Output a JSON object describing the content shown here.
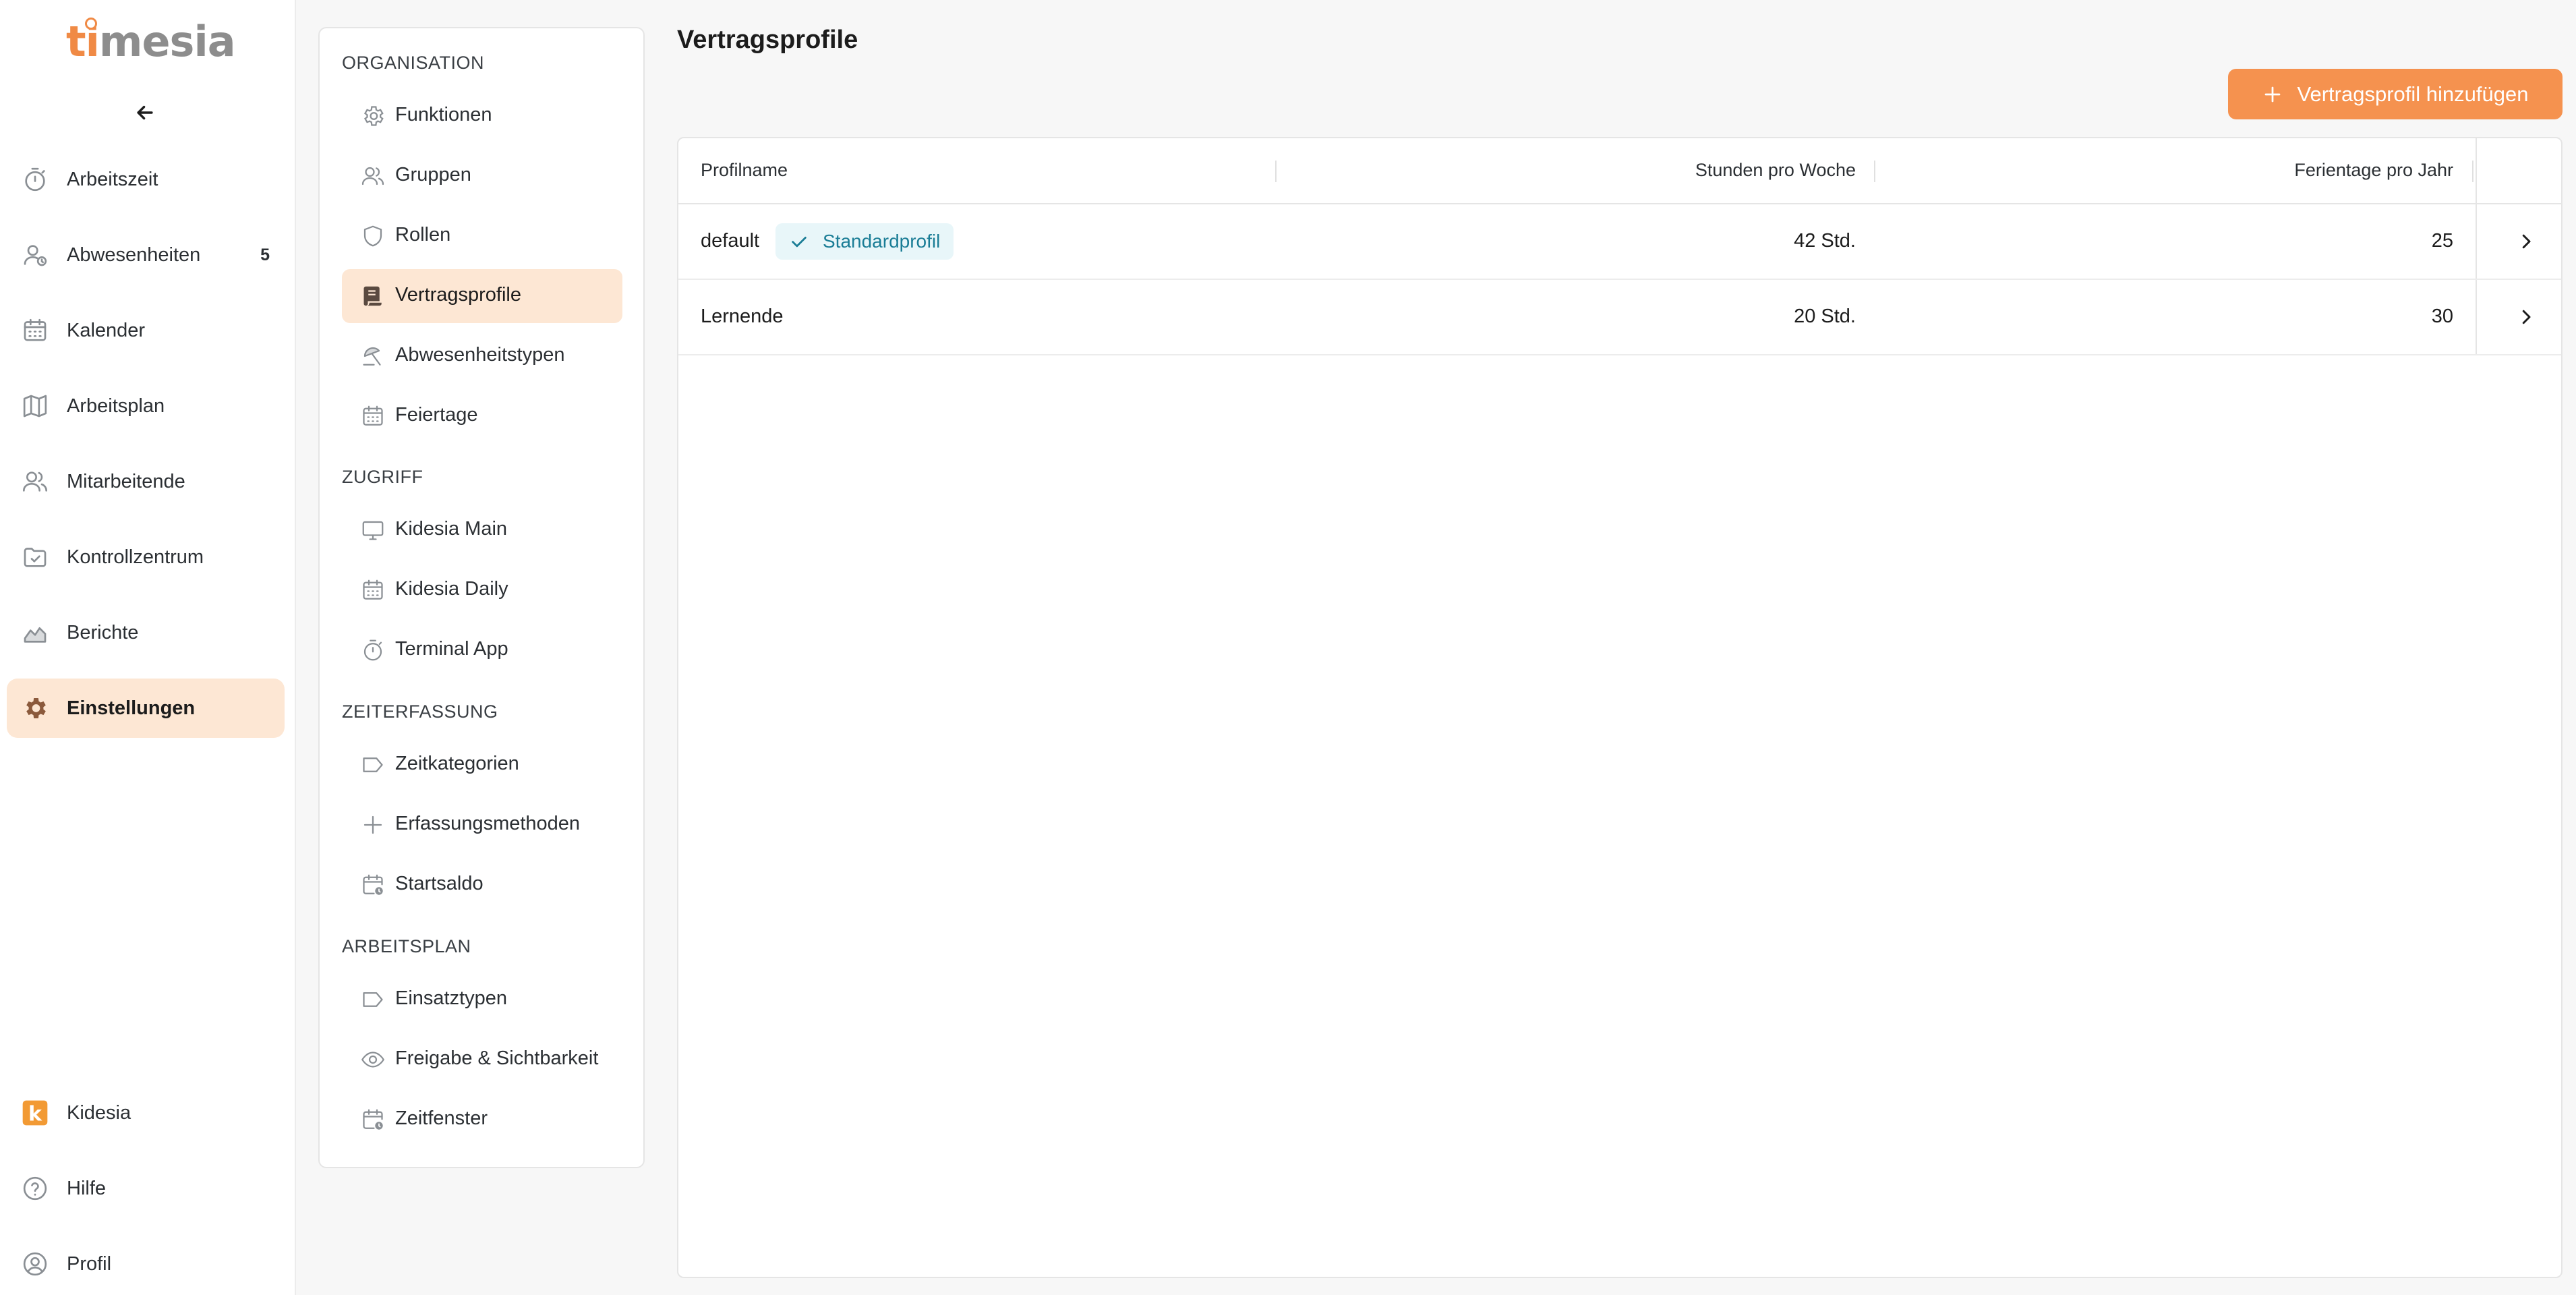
{
  "app": {
    "logo_ti": "ti",
    "logo_mesia": "mesia"
  },
  "sidebar": {
    "items": [
      {
        "label": "Arbeitszeit",
        "icon": "stopwatch-icon"
      },
      {
        "label": "Abwesenheiten",
        "icon": "user-absence-icon",
        "badge": "5"
      },
      {
        "label": "Kalender",
        "icon": "calendar-icon"
      },
      {
        "label": "Arbeitsplan",
        "icon": "map-icon"
      },
      {
        "label": "Mitarbeitende",
        "icon": "users-icon"
      },
      {
        "label": "Kontrollzentrum",
        "icon": "folder-check-icon"
      },
      {
        "label": "Berichte",
        "icon": "chart-area-icon"
      },
      {
        "label": "Einstellungen",
        "icon": "gear-icon",
        "active": true
      }
    ],
    "bottom": [
      {
        "label": "Kidesia",
        "icon": "kidesia-logo-icon",
        "glyph": "k"
      },
      {
        "label": "Hilfe",
        "icon": "help-circle-icon"
      },
      {
        "label": "Profil",
        "icon": "user-circle-icon"
      }
    ]
  },
  "submenu": {
    "sections": [
      {
        "title": "ORGANISATION",
        "items": [
          "Funktionen",
          "Gruppen",
          "Rollen",
          "Vertragsprofile",
          "Abwesenheitstypen",
          "Feiertage"
        ]
      },
      {
        "title": "ZUGRIFF",
        "items": [
          "Kidesia Main",
          "Kidesia Daily",
          "Terminal App"
        ]
      },
      {
        "title": "ZEITERFASSUNG",
        "items": [
          "Zeitkategorien",
          "Erfassungsmethoden",
          "Startsaldo"
        ]
      },
      {
        "title": "ARBEITSPLAN",
        "items": [
          "Einsatztypen",
          "Freigabe & Sichtbarkeit",
          "Zeitfenster"
        ]
      }
    ],
    "active": "Vertragsprofile"
  },
  "main": {
    "title": "Vertragsprofile",
    "add_button": "Vertragsprofil hinzufügen",
    "table": {
      "headers": {
        "name": "Profilname",
        "hours": "Stunden pro Woche",
        "days": "Ferientage pro Jahr"
      },
      "rows": [
        {
          "name": "default",
          "badge": "Standardprofil",
          "hours": "42 Std.",
          "days": "25"
        },
        {
          "name": "Lernende",
          "badge": "",
          "hours": "20 Std.",
          "days": "30"
        }
      ]
    }
  },
  "colors": {
    "accent": "#f5924f",
    "active_bg": "#fde7d4",
    "badge_bg": "#e8f6f9",
    "badge_fg": "#1a7d96"
  }
}
